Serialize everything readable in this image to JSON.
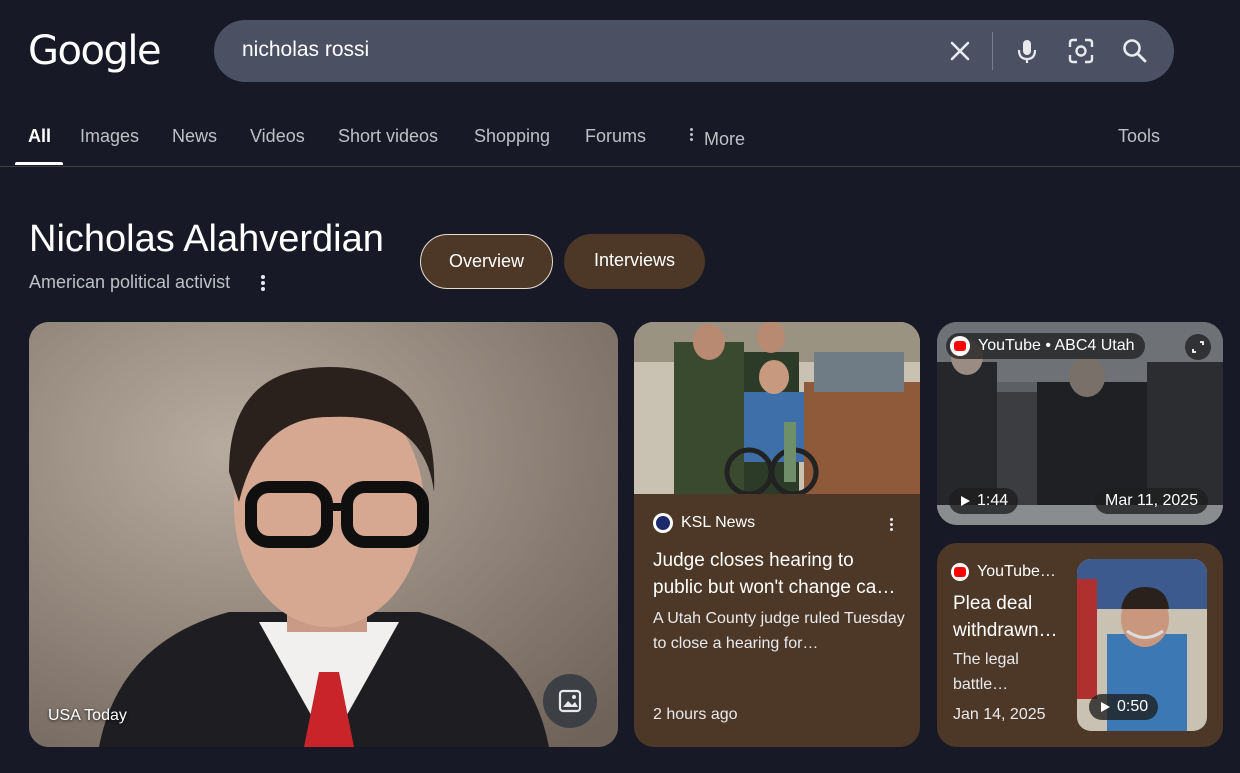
{
  "logo": "Google",
  "search": {
    "query": "nicholas rossi"
  },
  "tabs": [
    {
      "label": "All",
      "active": true
    },
    {
      "label": "Images"
    },
    {
      "label": "News"
    },
    {
      "label": "Videos"
    },
    {
      "label": "Short videos"
    },
    {
      "label": "Shopping"
    },
    {
      "label": "Forums"
    },
    {
      "label": "More"
    }
  ],
  "tools_label": "Tools",
  "entity": {
    "title": "Nicholas Alahverdian",
    "subtitle": "American political activist",
    "chips": [
      {
        "label": "Overview",
        "selected": true
      },
      {
        "label": "Interviews"
      }
    ]
  },
  "main_image": {
    "caption": "USA Today"
  },
  "news_card": {
    "source": "KSL News",
    "title": "Judge closes hearing to public but won't change ca…",
    "snippet": "A Utah County judge ruled Tuesday to close a hearing for…",
    "time": "2 hours ago"
  },
  "video_card": {
    "source": "YouTube • ABC4 Utah",
    "duration": "1:44",
    "date": "Mar 11, 2025"
  },
  "video_card2": {
    "source": "YouTube…",
    "title": "Plea deal withdrawn…",
    "snippet": "The legal battle…",
    "date": "Jan 14, 2025",
    "duration": "0:50"
  },
  "colors": {
    "background": "#171a26",
    "search_bg": "#4b5063",
    "card_brown": "#4d3827",
    "youtube_red": "#ff0000"
  },
  "icons": [
    "clear-icon",
    "mic-icon",
    "lens-icon",
    "search-icon",
    "more-vert-icon",
    "image-icon",
    "expand-icon",
    "play-icon"
  ]
}
